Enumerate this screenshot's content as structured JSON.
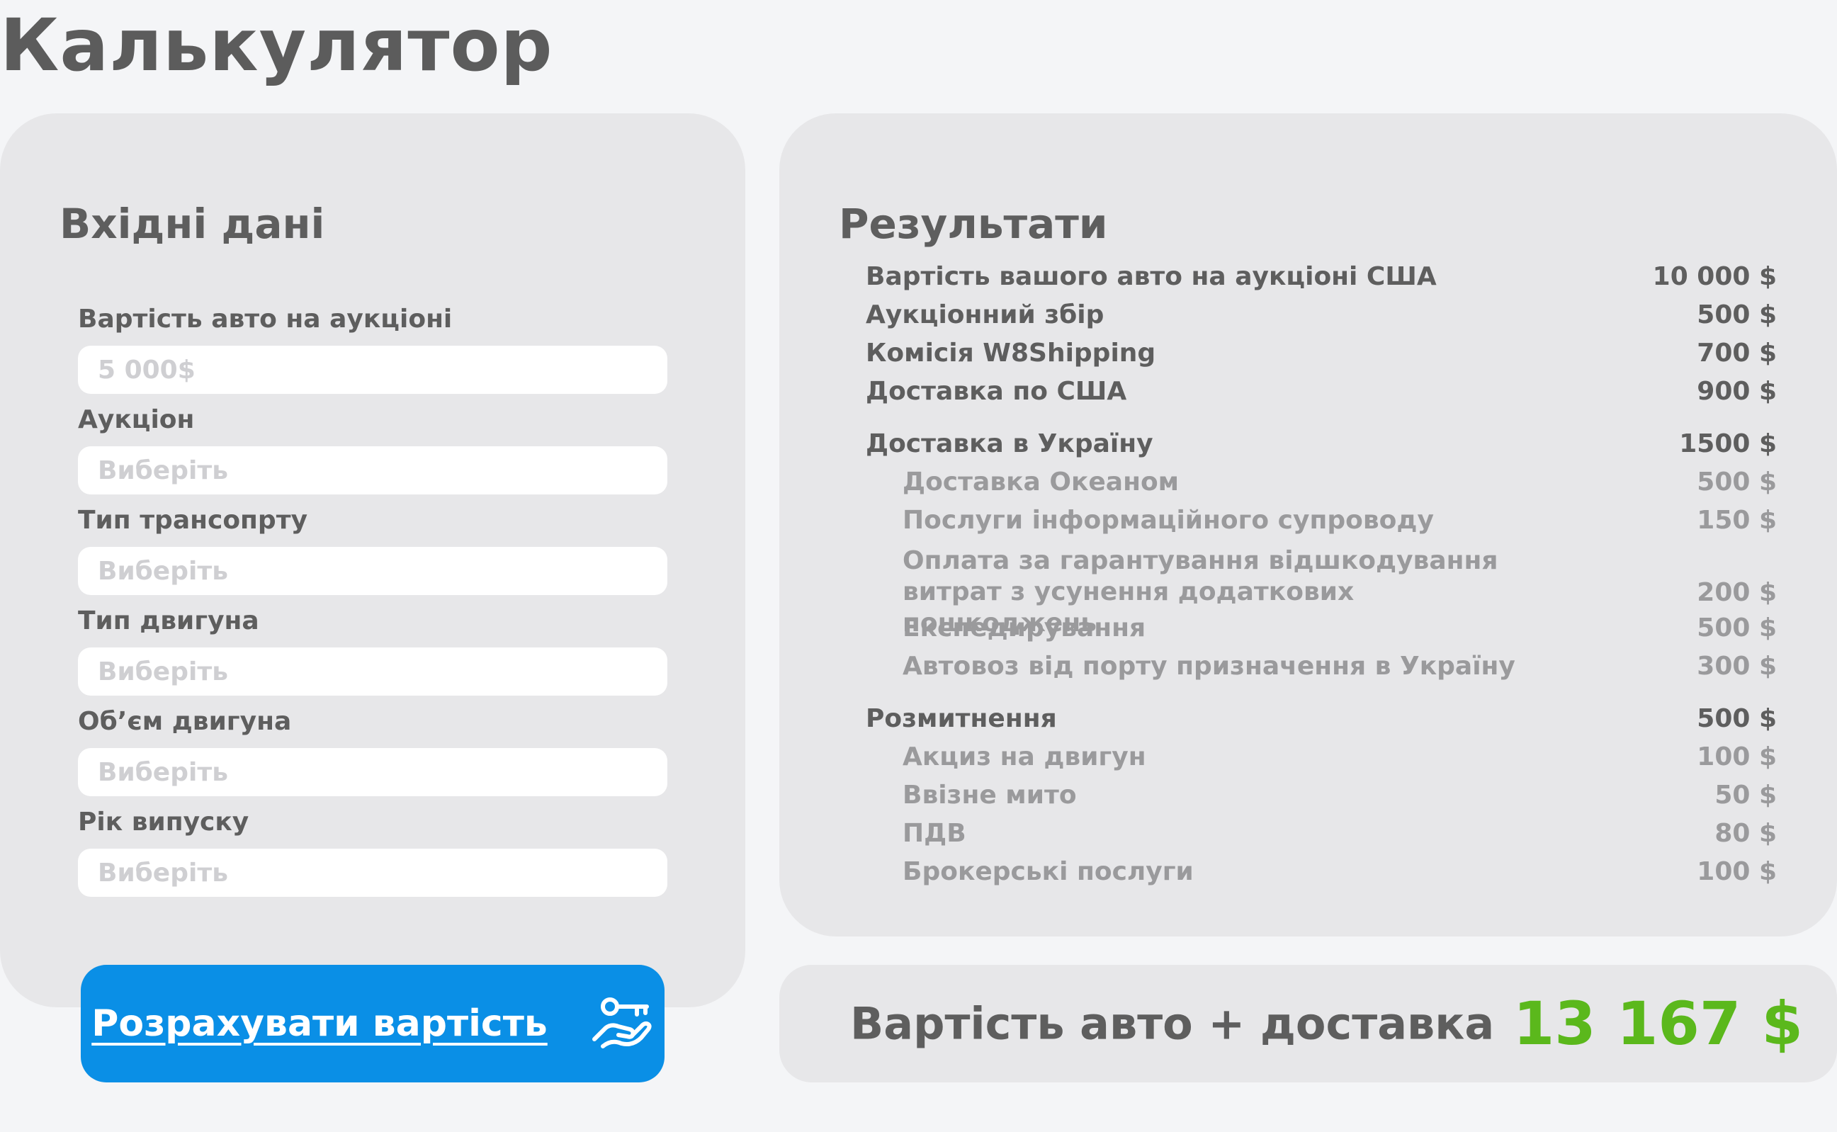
{
  "page": {
    "title": "Калькулятор"
  },
  "inputs": {
    "heading": "Вхідні дані",
    "fields": [
      {
        "label": "Вартість авто на аукціоні",
        "placeholder": "5 000$"
      },
      {
        "label": "Аукціон",
        "placeholder": "Виберіть"
      },
      {
        "label": "Тип трансопрту",
        "placeholder": "Виберіть"
      },
      {
        "label": "Тип двигуна",
        "placeholder": "Виберіть"
      },
      {
        "label": "Об’єм двигуна",
        "placeholder": "Виберіть"
      },
      {
        "label": "Рік випуску",
        "placeholder": "Виберіть"
      }
    ],
    "button_label": "Розрахувати вартість",
    "button_icon": "hand-key-icon"
  },
  "results": {
    "heading": "Результати",
    "rows": [
      {
        "label": "Вартість вашого авто на аукціоні США",
        "value": "10 000 $"
      },
      {
        "label": "Аукціонний збір",
        "value": "500 $"
      },
      {
        "label": "Комісія W8Shipping",
        "value": "700 $"
      },
      {
        "label": "Доставка по США",
        "value": "900 $"
      },
      {
        "label": "Доставка в Україну",
        "value": "1500 $"
      },
      {
        "label": "Доставка Океаном",
        "value": "500 $"
      },
      {
        "label": "Послуги інформаційного супроводу",
        "value": "150 $"
      },
      {
        "label": "Оплата за гарантування відшкодування витрат з усунення додаткових пошкоджень",
        "value": "200 $"
      },
      {
        "label": "Експедирування",
        "value": "500 $"
      },
      {
        "label": "Автовоз від порту призначення в Україну",
        "value": "300 $"
      },
      {
        "label": "Розмитнення",
        "value": "500 $"
      },
      {
        "label": "Акциз на двигун",
        "value": "100 $"
      },
      {
        "label": "Ввізне мито",
        "value": "50 $"
      },
      {
        "label": "ПДВ",
        "value": "80 $"
      },
      {
        "label": "Брокерські послуги",
        "value": "100 $"
      }
    ]
  },
  "total": {
    "label": "Вартість авто + доставка",
    "value": "13 167 $"
  },
  "colors": {
    "accent": "#0a8fe6",
    "total_value": "#5bb81c",
    "panel_bg": "#e7e7e9",
    "text": "#5e5e5e",
    "muted": "#9a9a9c",
    "placeholder": "#cfcfd2"
  }
}
